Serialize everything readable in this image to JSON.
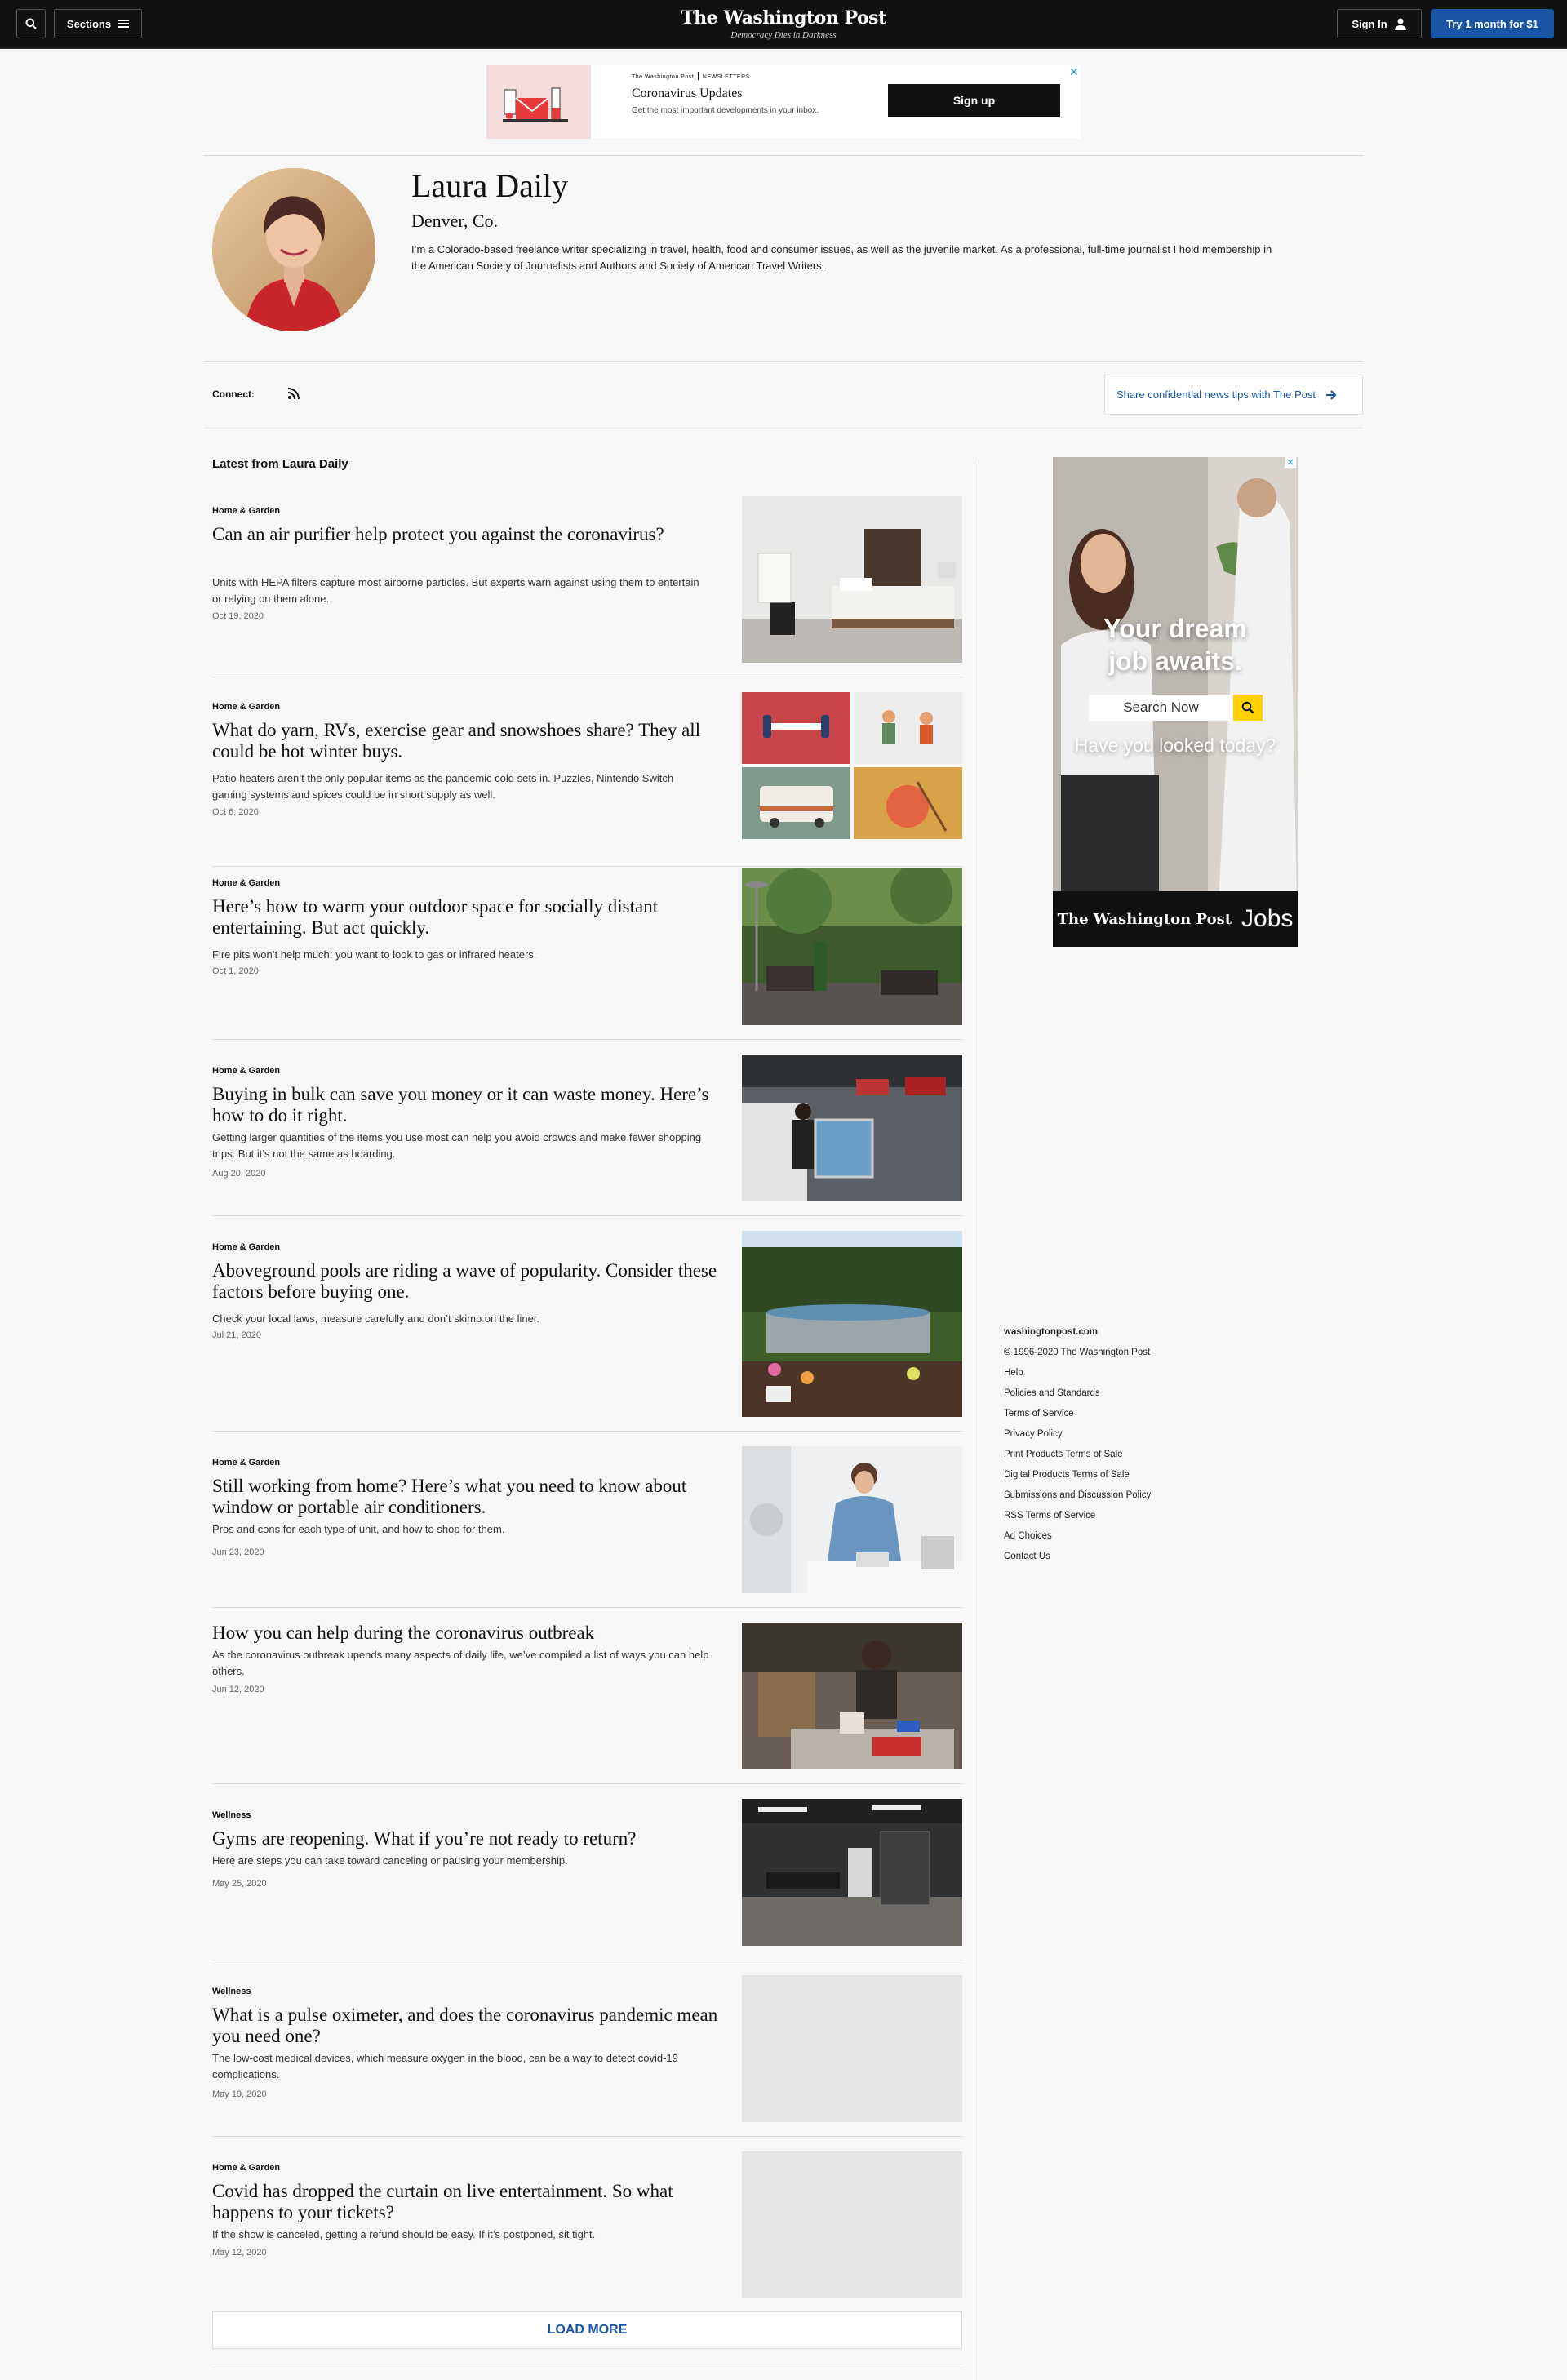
{
  "header": {
    "sections_label": "Sections",
    "logo_name": "The Washington Post",
    "logo_tagline": "Democracy Dies in Darkness",
    "signin_label": "Sign In",
    "trial_label": "Try 1 month for $1"
  },
  "newsletter": {
    "brand": "The Washington Post",
    "brand_sub": "NEWSLETTERS",
    "title": "Coronavirus Updates",
    "description": "Get the most important developments in your inbox.",
    "signup_label": "Sign up",
    "close_glyph": "✕"
  },
  "author": {
    "name": "Laura Daily",
    "location": "Denver, Co.",
    "bio": "I’m a Colorado-based freelance writer specializing in travel, health, food and consumer issues, as well as the juvenile market. As a professional, full-time journalist I hold membership in the American Society of Journalists and Authors and Society of American Travel Writers.",
    "connect_label": "Connect:",
    "tips_label": "Share confidential news tips with The Post"
  },
  "latest": {
    "title": "Latest from Laura Daily",
    "load_more": "LOAD MORE",
    "stories": [
      {
        "kicker": "Home & Garden",
        "headline": "Can an air purifier help protect you against the coronavirus?",
        "blurb": "Units with HEPA filters capture most airborne particles. But experts warn against using them to entertain or relying on them alone.",
        "date": "Oct 19, 2020"
      },
      {
        "kicker": "Home & Garden",
        "headline": "What do yarn, RVs, exercise gear and snowshoes share? They all could be hot winter buys.",
        "blurb": "Patio heaters aren’t the only popular items as the pandemic cold sets in. Puzzles, Nintendo Switch gaming systems and spices could be in short supply as well.",
        "date": "Oct 6, 2020"
      },
      {
        "kicker": "Home & Garden",
        "headline": "Here’s how to warm your outdoor space for socially distant entertaining. But act quickly.",
        "blurb": "Fire pits won’t help much; you want to look to gas or infrared heaters.",
        "date": "Oct 1, 2020"
      },
      {
        "kicker": "Home & Garden",
        "headline": "Buying in bulk can save you money or it can waste money. Here’s how to do it right.",
        "blurb": "Getting larger quantities of the items you use most can help you avoid crowds and make fewer shopping trips. But it’s not the same as hoarding.",
        "date": "Aug 20, 2020"
      },
      {
        "kicker": "Home & Garden",
        "headline": "Aboveground pools are riding a wave of popularity. Consider these factors before buying one.",
        "blurb": "Check your local laws, measure carefully and don’t skimp on the liner.",
        "date": "Jul 21, 2020"
      },
      {
        "kicker": "Home & Garden",
        "headline": "Still working from home? Here’s what you need to know about window or portable air conditioners.",
        "blurb": "Pros and cons for each type of unit, and how to shop for them.",
        "date": "Jun 23, 2020"
      },
      {
        "kicker": "",
        "headline": "How you can help during the coronavirus outbreak",
        "blurb": "As the coronavirus outbreak upends many aspects of daily life, we’ve compiled a list of ways you can help others.",
        "date": "Jun 12, 2020"
      },
      {
        "kicker": "Wellness",
        "headline": "Gyms are reopening. What if you’re not ready to return?",
        "blurb": "Here are steps you can take toward canceling or pausing your membership.",
        "date": "May 25, 2020"
      },
      {
        "kicker": "Wellness",
        "headline": "What is a pulse oximeter, and does the coronavirus pandemic mean you need one?",
        "blurb": "The low-cost medical devices, which measure oxygen in the blood, can be a way to detect covid-19 complications.",
        "date": "May 19, 2020"
      },
      {
        "kicker": "Home & Garden",
        "headline": "Covid has dropped the curtain on live entertainment. So what happens to your tickets?",
        "blurb": "If the show is canceled, getting a refund should be easy. If it’s postponed, sit tight.",
        "date": "May 12, 2020"
      }
    ]
  },
  "ad": {
    "headline_1": "Your dream",
    "headline_2": "job awaits.",
    "search_label": "Search Now",
    "question": "Have you looked today?",
    "brand": "The Washington Post",
    "product": "Jobs",
    "close_glyph": "✕"
  },
  "footer": {
    "site": "washingtonpost.com",
    "copyright": "© 1996-2020 The Washington Post",
    "links": [
      "Help",
      "Policies and Standards",
      "Terms of Service",
      "Privacy Policy",
      "Print Products Terms of Sale",
      "Digital Products Terms of Sale",
      "Submissions and Discussion Policy",
      "RSS Terms of Service",
      "Ad Choices",
      "Contact Us"
    ]
  },
  "colors": {
    "accent": "#1955a5",
    "topbar": "#111111",
    "background": "#f7f7f7",
    "ad_search": "#ffd200"
  }
}
